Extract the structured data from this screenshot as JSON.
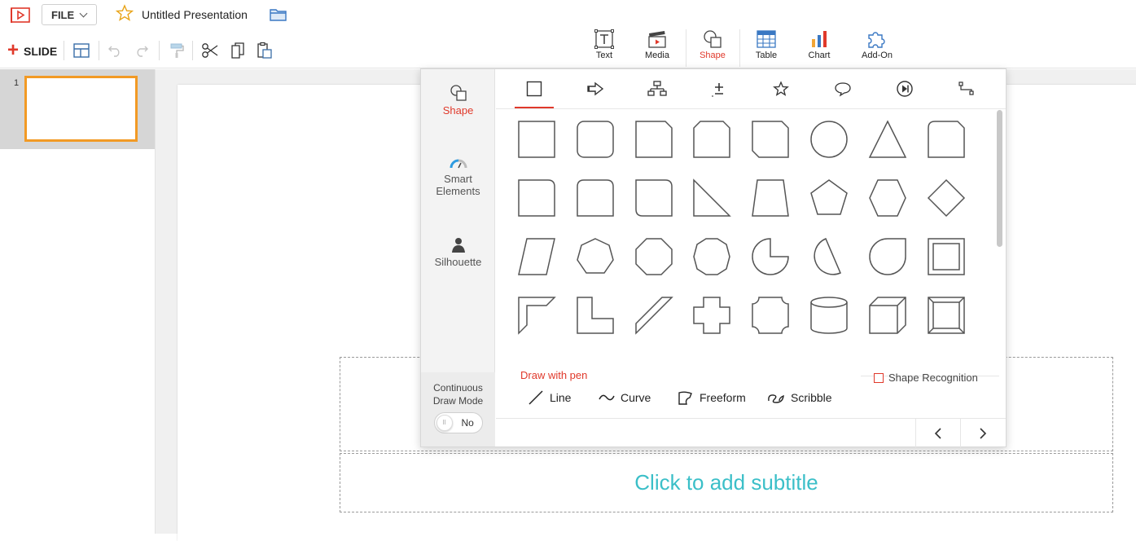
{
  "header": {
    "file_label": "FILE",
    "title": "Untitled Presentation",
    "slide_label": "SLIDE"
  },
  "insert_tools": [
    {
      "label": "Text",
      "icon": "text-box-icon"
    },
    {
      "label": "Media",
      "icon": "media-clapper-icon"
    },
    {
      "label": "Shape",
      "icon": "shape-icon",
      "active": true
    },
    {
      "label": "Table",
      "icon": "table-icon"
    },
    {
      "label": "Chart",
      "icon": "chart-icon"
    },
    {
      "label": "Add-On",
      "icon": "puzzle-icon"
    }
  ],
  "slides": [
    {
      "number": "1"
    }
  ],
  "canvas": {
    "subtitle_placeholder": "Click to add subtitle"
  },
  "shape_popup": {
    "side": {
      "shape": "Shape",
      "smart_elements_line1": "Smart",
      "smart_elements_line2": "Elements",
      "silhouette": "Silhouette",
      "continuous_line1": "Continuous",
      "continuous_line2": "Draw Mode",
      "toggle_value": "No",
      "toggle_knob": "II"
    },
    "draw_with_pen": "Draw with pen",
    "shape_recognition": "Shape Recognition",
    "pen_tools": [
      "Line",
      "Curve",
      "Freeform",
      "Scribble"
    ]
  },
  "colors": {
    "accent": "#e0392b",
    "selection": "#f29a25",
    "placeholder": "#3bbfc8"
  }
}
